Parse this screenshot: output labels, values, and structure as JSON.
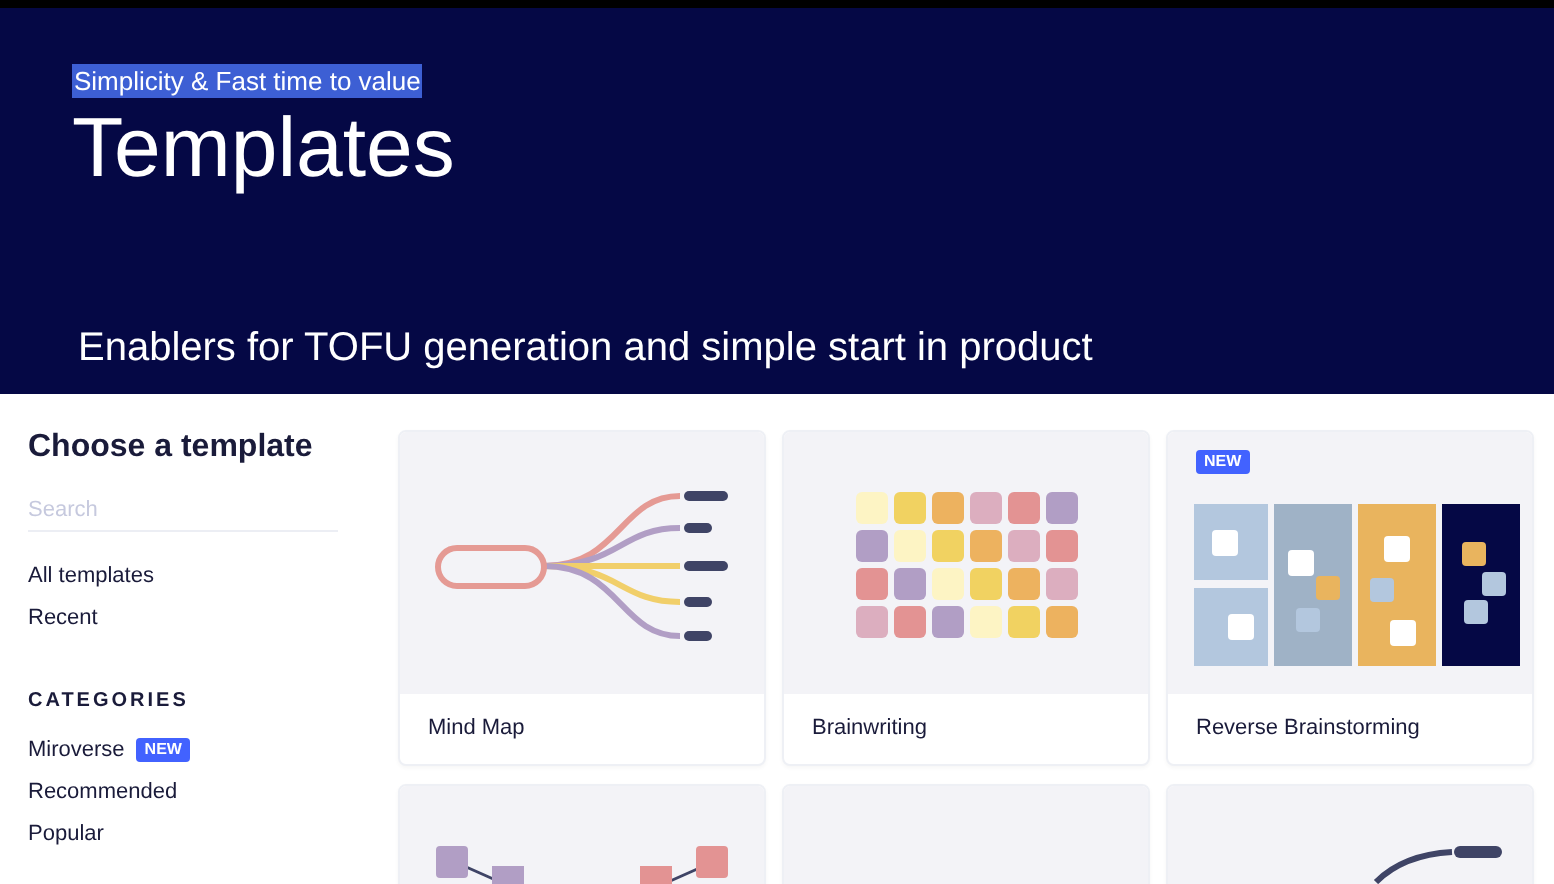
{
  "banner": {
    "eyebrow": {
      "text": "Simplicity & Fast time to value",
      "highlighted": true
    },
    "title": "Templates",
    "tagline": "Enablers for TOFU generation and simple start in product"
  },
  "sidebar": {
    "title": "Choose a template",
    "search": {
      "placeholder": "Search"
    },
    "links": [
      {
        "label": "All templates"
      },
      {
        "label": "Recent"
      }
    ],
    "section": "CATEGORIES",
    "categories": [
      {
        "label": "Miroverse",
        "badge": "NEW"
      },
      {
        "label": "Recommended"
      },
      {
        "label": "Popular"
      }
    ]
  },
  "cards": [
    {
      "kind": "mind-map",
      "title": "Mind Map"
    },
    {
      "kind": "brainwriting",
      "title": "Brainwriting"
    },
    {
      "kind": "reverse-brainstorming",
      "title": "Reverse Brainstorming",
      "badge": "NEW"
    },
    {
      "kind": "flow"
    },
    {
      "kind": "blank"
    },
    {
      "kind": "curve"
    }
  ]
}
